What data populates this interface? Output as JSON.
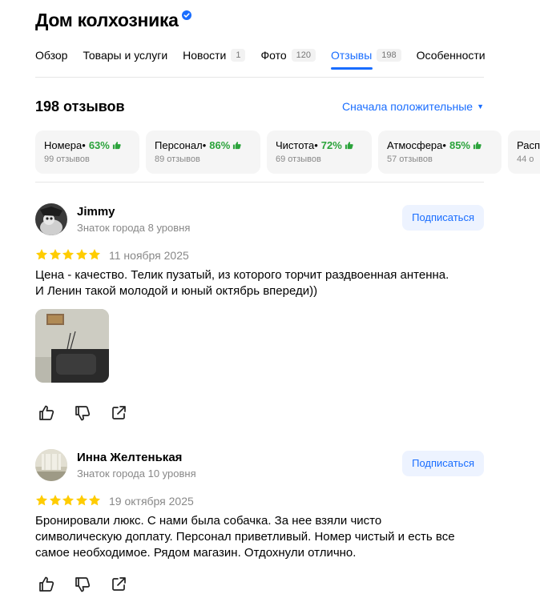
{
  "title": "Дом колхозника",
  "tabs": [
    {
      "label": "Обзор",
      "count": ""
    },
    {
      "label": "Товары и услуги",
      "count": ""
    },
    {
      "label": "Новости",
      "count": "1"
    },
    {
      "label": "Фото",
      "count": "120"
    },
    {
      "label": "Отзывы",
      "count": "198"
    },
    {
      "label": "Особенности",
      "count": ""
    }
  ],
  "reviews_count": "198 отзывов",
  "sort_label": "Сначала положительные",
  "aspects": [
    {
      "name": "Номера",
      "sep": " •",
      "pct": "63%",
      "sub": "99 отзывов"
    },
    {
      "name": "Персонал",
      "sep": " •",
      "pct": "86%",
      "sub": "89 отзывов"
    },
    {
      "name": "Чистота",
      "sep": " •",
      "pct": "72%",
      "sub": "69 отзывов"
    },
    {
      "name": "Атмосфера",
      "sep": " •",
      "pct": "85%",
      "sub": "57 отзывов"
    },
    {
      "name": "Расп",
      "sep": "",
      "pct": "",
      "sub": "44 о"
    }
  ],
  "reviews": [
    {
      "author": "Jimmy",
      "level": "Знаток города 8 уровня",
      "subscribe": "Подписаться",
      "rating": 5,
      "date": "11 ноября 2025",
      "text_lines": [
        "Цена - качество. Телик пузатый, из которого торчит раздвоенная антенна.",
        "И Ленин такой молодой и юный октябрь впереди))"
      ]
    },
    {
      "author": "Инна Желтенькая",
      "level": "Знаток города 10 уровня",
      "subscribe": "Подписаться",
      "rating": 5,
      "date": "19 октября 2025",
      "text_lines": [
        "Бронировали люкс. С нами была собачка. За нее взяли чисто",
        "символическую доплату. Персонал приветливый. Номер чистый и есть все",
        "самое необходимое. Рядом магазин. Отдохнули отлично."
      ]
    }
  ],
  "colors": {
    "accent": "#196dff",
    "star": "#fc0",
    "positive": "#2ba33b"
  }
}
